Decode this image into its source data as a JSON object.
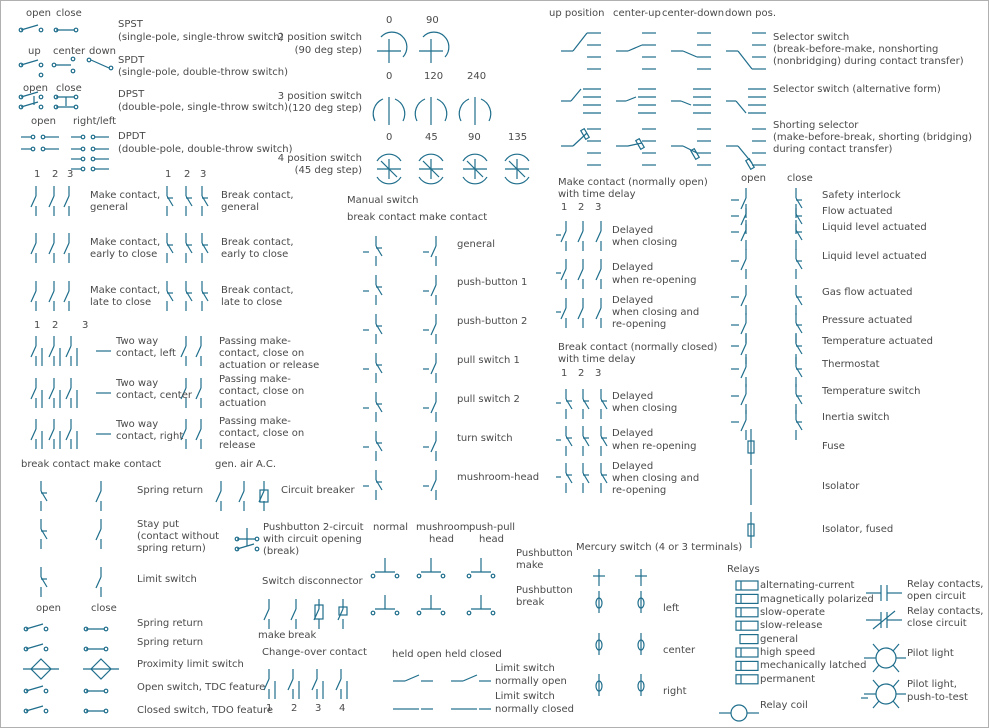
{
  "colors": {
    "symbol": "#1f6e8c",
    "text": "#4a4a4a"
  },
  "basic": {
    "spst_states": [
      "open",
      "close"
    ],
    "spst": [
      "SPST",
      "(single-pole, single-throw switch)"
    ],
    "spdt_states": [
      "up",
      "center",
      "down"
    ],
    "spdt": [
      "SPDT",
      "(single-pole, double-throw switch)"
    ],
    "dpst_states": [
      "open",
      "close"
    ],
    "dpst": [
      "DPST",
      "(double-pole, single-throw switch)"
    ],
    "dpdt_states": [
      "open",
      "right/left"
    ],
    "dpdt": [
      "DPDT",
      "(double-pole, double-throw switch)"
    ]
  },
  "rotary": {
    "two": [
      "2 position switch",
      "(90 deg step)"
    ],
    "two_angles": [
      "0",
      "90"
    ],
    "three": [
      "3 position switch",
      "(120 deg step)"
    ],
    "three_angles": [
      "0",
      "120",
      "240"
    ],
    "four": [
      "4 position switch",
      "(45 deg step)"
    ],
    "four_angles": [
      "0",
      "45",
      "90",
      "135"
    ]
  },
  "selector": {
    "positions": [
      "up position",
      "center-up",
      "center-down",
      "down pos."
    ],
    "selector": [
      "Selector switch",
      "(break-before-make, nonshorting",
      "(nonbridging) during contact transfer)"
    ],
    "alternative": "Selector switch (alternative form)",
    "shorting": [
      "Shorting selector",
      "(make-before-break, shorting (bridging)",
      "during contact transfer)"
    ]
  },
  "contacts": {
    "nums": [
      "1",
      "2",
      "3"
    ],
    "make_general": [
      "Make contact,",
      "general"
    ],
    "break_general": [
      "Break contact,",
      "general"
    ],
    "make_early": [
      "Make contact,",
      "early to close"
    ],
    "break_early": [
      "Break contact,",
      "early to close"
    ],
    "make_late": [
      "Make contact,",
      "late to close"
    ],
    "break_late": [
      "Break contact,",
      "late to close"
    ],
    "two_way_left": [
      "Two way",
      "contact, left"
    ],
    "two_way_center": [
      "Two way",
      "contact, center"
    ],
    "two_way_right": [
      "Two way",
      "contact, right"
    ],
    "passing1": [
      "Passing make-",
      "contact, close on",
      "actuation or release"
    ],
    "passing2": [
      "Passing make-",
      "contact, close on",
      "actuation"
    ],
    "passing3": [
      "Passing make-",
      "contact, close on",
      "release"
    ]
  },
  "spring": {
    "header": "break contact make contact",
    "spring_return": "Spring return",
    "stay_put": [
      "Stay put",
      "(contact without",
      "spring return)"
    ],
    "limit_switch": "Limit switch",
    "states": [
      "open",
      "close"
    ],
    "list": [
      "Spring return",
      "Spring return",
      "Proximity limit switch",
      "Open switch, TDC feature",
      "Closed switch, TDO feature"
    ]
  },
  "breaker": {
    "types": [
      "gen.",
      "air",
      "A.C."
    ],
    "circuit_breaker": "Circuit breaker",
    "pushbutton_2circuit": [
      "Pushbutton 2-circuit",
      "with circuit opening",
      "(break)"
    ],
    "switch_disconnector": "Switch disconnector",
    "make_break": [
      "make",
      "break"
    ],
    "changeover": "Change-over contact",
    "changeover_nums": [
      "1",
      "2",
      "3",
      "4"
    ]
  },
  "manual": {
    "title": "Manual switch",
    "header": "break contact make contact",
    "items": [
      "general",
      "push-button 1",
      "push-button 2",
      "pull switch 1",
      "pull switch 2",
      "turn switch",
      "mushroom-head"
    ]
  },
  "pushbutton": {
    "cols": [
      "normal",
      "mushroom",
      "head",
      "push-pull",
      "head"
    ],
    "make": [
      "Pushbutton",
      "make"
    ],
    "break": [
      "Pushbutton",
      "break"
    ],
    "held": [
      "held open",
      "held closed"
    ],
    "limit_no": [
      "Limit switch",
      "normally open"
    ],
    "limit_nc": [
      "Limit switch",
      "normally closed"
    ]
  },
  "timedelay": {
    "make_title": [
      "Make contact (normally open)",
      "with time delay"
    ],
    "break_title": [
      "Break contact (normally closed)",
      "with time delay"
    ],
    "nums": [
      "1",
      "2",
      "3"
    ],
    "closing": [
      "Delayed",
      "when closing"
    ],
    "reopening": [
      "Delayed",
      "when re-opening"
    ],
    "both": [
      "Delayed",
      "when closing and",
      "re-opening"
    ]
  },
  "mercury": {
    "title": "Mercury switch (4 or 3 terminals)",
    "items": [
      "left",
      "center",
      "right"
    ]
  },
  "actuated": {
    "states": [
      "open",
      "close"
    ],
    "items": [
      "Safety interlock",
      "Flow actuated",
      "Liquid level actuated",
      "Liquid level actuated",
      "Gas flow actuated",
      "Pressure actuated",
      "Temperature actuated",
      "Thermostat",
      "Temperature switch",
      "Inertia switch",
      "Fuse",
      "Isolator",
      "Isolator, fused"
    ]
  },
  "relays": {
    "title": "Relays",
    "items": [
      "alternating-current",
      "magnetically polarized",
      "slow-operate",
      "slow-release",
      "general",
      "high speed",
      "mechanically latched",
      "permanent"
    ],
    "coil": "Relay coil",
    "contacts_open": [
      "Relay contacts,",
      "open circuit"
    ],
    "contacts_close": [
      "Relay contacts,",
      "close circuit"
    ],
    "pilot": "Pilot light",
    "pilot_test": [
      "Pilot light,",
      "push-to-test"
    ]
  }
}
